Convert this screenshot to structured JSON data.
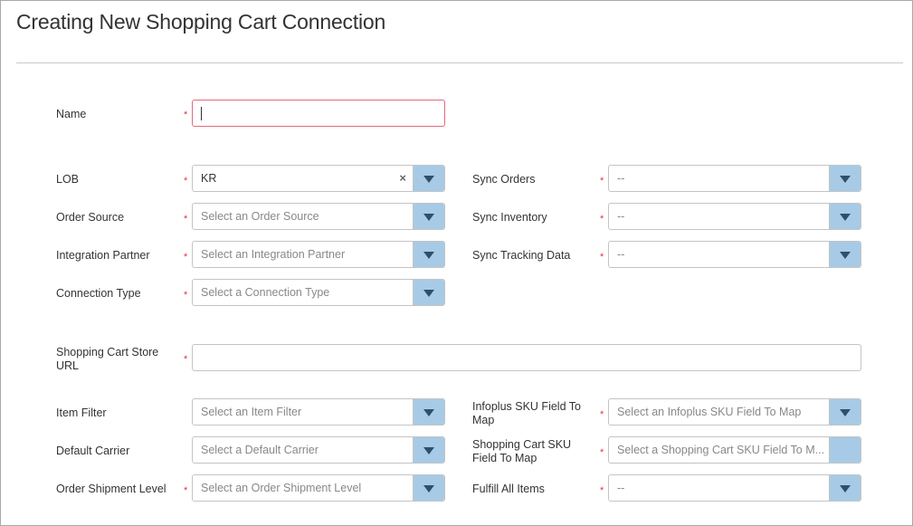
{
  "title": "Creating New Shopping Cart Connection",
  "fields": {
    "name": {
      "label": "Name",
      "value": ""
    },
    "lob": {
      "label": "LOB",
      "value": "KR"
    },
    "order_source": {
      "label": "Order Source",
      "placeholder": "Select an Order Source"
    },
    "integration_partner": {
      "label": "Integration Partner",
      "placeholder": "Select an Integration Partner"
    },
    "connection_type": {
      "label": "Connection Type",
      "placeholder": "Select a Connection Type"
    },
    "sync_orders": {
      "label": "Sync Orders",
      "value": "--"
    },
    "sync_inventory": {
      "label": "Sync Inventory",
      "value": "--"
    },
    "sync_tracking": {
      "label": "Sync Tracking Data",
      "value": "--"
    },
    "store_url": {
      "label": "Shopping Cart Store URL",
      "value": ""
    },
    "item_filter": {
      "label": "Item Filter",
      "placeholder": "Select an Item Filter"
    },
    "default_carrier": {
      "label": "Default Carrier",
      "placeholder": "Select a Default Carrier"
    },
    "order_shipment_level": {
      "label": "Order Shipment Level",
      "placeholder": "Select an Order Shipment Level"
    },
    "infoplus_sku": {
      "label": "Infoplus SKU Field To Map",
      "placeholder": "Select an Infoplus SKU Field To Map"
    },
    "cart_sku": {
      "label": "Shopping Cart SKU Field To Map",
      "placeholder": "Select a Shopping Cart SKU Field To M..."
    },
    "fulfill_all": {
      "label": "Fulfill All Items",
      "value": "--"
    }
  },
  "required_mark": "*",
  "clear_icon": "×",
  "icons": {
    "dropdown": "caret-down-icon",
    "clear": "clear-icon"
  },
  "colors": {
    "accent_button": "#a7cbe6",
    "required": "#e0353b",
    "active_border": "#e06a7a"
  }
}
